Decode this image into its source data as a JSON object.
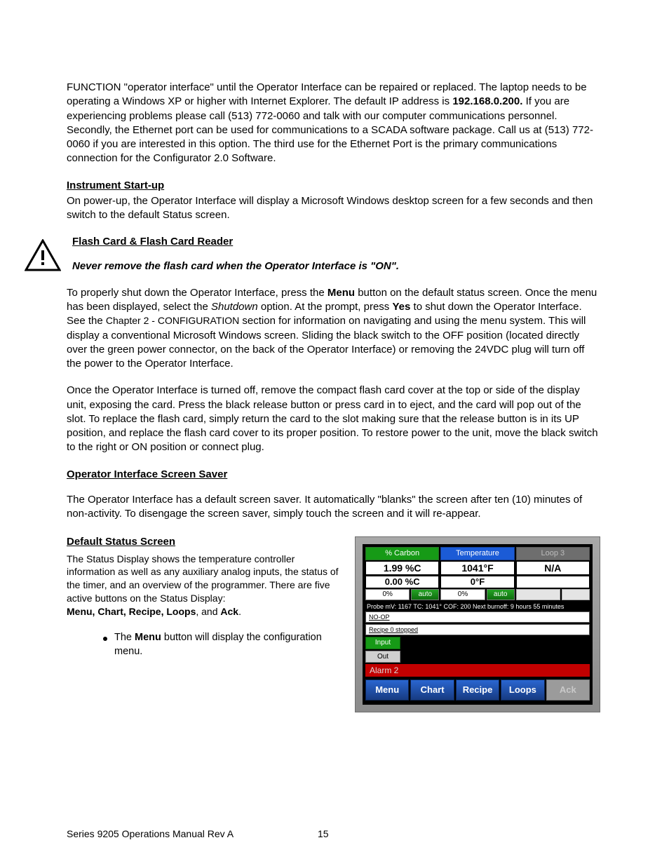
{
  "para_intro": {
    "pre_ip": "FUNCTION \"operator interface\" until the Operator Interface can be repaired or replaced. The laptop needs to be operating a Windows XP or higher with Internet Explorer. The default IP address is ",
    "ip": "192.168.0.200.",
    "post_ip": " If you are experiencing problems please call (513) 772-0060 and talk with our computer communications personnel.  Secondly, the Ethernet port can be used for communications to a SCADA software package. Call us at (513) 772-0060 if you are interested in this option. The third use for the Ethernet Port is the primary communications connection for the Configurator 2.0 Software."
  },
  "startup": {
    "heading": "Instrument Start-up",
    "body": "On power-up, the Operator Interface will display a Microsoft Windows desktop screen for a few seconds and then switch to the default Status screen."
  },
  "flash": {
    "heading": "Flash Card & Flash Card Reader",
    "warning": "Never remove the flash card when the Operator Interface is \"ON\".",
    "p1": {
      "a": "To properly shut down the Operator Interface, press the ",
      "menu": "Menu",
      "b": " button on the default status screen. Once the menu has been displayed, select the ",
      "shutdown": "Shutdown",
      "c": " option.  At the prompt, press ",
      "yes": "Yes",
      "d": " to shut down the Operator Interface.  See the ",
      "chapter": "Chapter 2 - ",
      "config": "CONFIGURATION",
      "e": " section for information on navigating and using the menu system.  This will display a conventional Microsoft Windows screen.  Sliding the black switch to the OFF position (located directly over the green power connector, on the back of the Operator Interface) or removing the 24VDC plug will turn off the power to the Operator Interface."
    },
    "p2": "Once the Operator Interface is turned off, remove the compact flash card cover at the top or side of the display unit, exposing the card.  Press the black release button or press card in to eject, and the card will pop out of the slot.  To replace the flash card, simply return the card to the slot making sure that the release button is in its UP position, and replace the flash card cover to its proper position.  To restore power to the unit, move the black switch to the right or ON position or connect plug."
  },
  "saver": {
    "heading": "Operator Interface Screen Saver",
    "body": "The Operator Interface has a default screen saver. It automatically \"blanks\" the screen after ten (10) minutes of non-activity. To disengage the screen saver, simply touch the screen and it will re-appear."
  },
  "default_screen": {
    "heading": "Default Status Screen",
    "body_a": "The Status Display shows the temperature controller information as well as any auxiliary analog inputs, the status of the timer, and an overview of the programmer. There are five active buttons on the Status Display: ",
    "btns": "Menu, Chart, Recipe, Loops",
    "body_b": ", and ",
    "ack": "Ack",
    "body_c": ".",
    "bullet_a": "The ",
    "bullet_menu": "Menu",
    "bullet_b": " button will display the configuration menu."
  },
  "device": {
    "tabs": [
      "% Carbon",
      "Temperature",
      "Loop 3"
    ],
    "vals_big": [
      "1.99 %C",
      "1041°F",
      "N/A"
    ],
    "vals_small": [
      "0.00 %C",
      "0°F",
      ""
    ],
    "pct": "0%",
    "auto": "auto",
    "probe": "Probe mV: 1167 TC: 1041° COF: 200 Next burnoff: 9 hours 55 minutes",
    "noop": "NO-OP",
    "recipe": "Recipe 0 stopped",
    "io_input": "Input",
    "io_out": "Out",
    "alarm": "Alarm 2",
    "menu_btns": [
      "Menu",
      "Chart",
      "Recipe",
      "Loops",
      "Ack"
    ]
  },
  "footer": {
    "left": "Series 9205 Operations Manual Rev A",
    "page": "15"
  }
}
